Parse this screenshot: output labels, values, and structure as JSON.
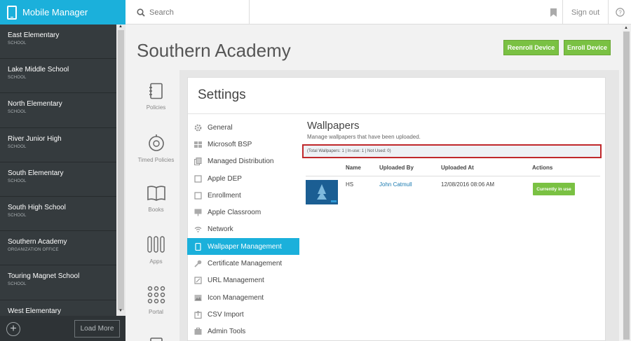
{
  "app": {
    "title": "Mobile Manager"
  },
  "search": {
    "placeholder": "Search"
  },
  "header": {
    "signout_label": "Sign out"
  },
  "sidebar": {
    "orgs": [
      {
        "name": "East Elementary",
        "type": "SCHOOL"
      },
      {
        "name": "Lake Middle School",
        "type": "SCHOOL"
      },
      {
        "name": "North Elementary",
        "type": "SCHOOL"
      },
      {
        "name": "River Junior High",
        "type": "SCHOOL"
      },
      {
        "name": "South Elementary",
        "type": "SCHOOL"
      },
      {
        "name": "South High School",
        "type": "SCHOOL"
      },
      {
        "name": "Southern Academy",
        "type": "ORGANIZATION OFFICE"
      },
      {
        "name": "Touring Magnet School",
        "type": "SCHOOL"
      },
      {
        "name": "West Elementary",
        "type": ""
      }
    ],
    "load_more": "Load More"
  },
  "page": {
    "title": "Southern Academy",
    "reenroll_label": "Reenroll Device",
    "enroll_label": "Enroll Device"
  },
  "side_icons": [
    {
      "label": "Policies",
      "icon": "notebook-icon"
    },
    {
      "label": "Timed Policies",
      "icon": "stopwatch-icon"
    },
    {
      "label": "Books",
      "icon": "book-icon"
    },
    {
      "label": "Apps",
      "icon": "apps-icon"
    },
    {
      "label": "Portal",
      "icon": "grid-dots-icon"
    }
  ],
  "settings": {
    "title": "Settings",
    "menu": [
      {
        "label": "General",
        "icon": "gear-icon"
      },
      {
        "label": "Microsoft BSP",
        "icon": "windows-icon"
      },
      {
        "label": "Managed Distribution",
        "icon": "copy-icon"
      },
      {
        "label": "Apple DEP",
        "icon": "checkbox-icon"
      },
      {
        "label": "Enrollment",
        "icon": "checkbox-icon"
      },
      {
        "label": "Apple Classroom",
        "icon": "presentation-icon"
      },
      {
        "label": "Network",
        "icon": "wifi-icon"
      },
      {
        "label": "Wallpaper Management",
        "icon": "tablet-icon",
        "active": true
      },
      {
        "label": "Certificate Management",
        "icon": "key-icon"
      },
      {
        "label": "URL Management",
        "icon": "link-icon"
      },
      {
        "label": "Icon Management",
        "icon": "image-icon"
      },
      {
        "label": "CSV Import",
        "icon": "upload-icon"
      },
      {
        "label": "Admin Tools",
        "icon": "tools-icon"
      }
    ]
  },
  "wallpapers": {
    "title": "Wallpapers",
    "subtitle": "Manage wallpapers that have been uploaded.",
    "totals": "(Total Wallpapers: 1 | In-use: 1 | Not Used: 0)",
    "columns": {
      "name": "Name",
      "uploaded_by": "Uploaded By",
      "uploaded_at": "Uploaded At",
      "actions": "Actions"
    },
    "rows": [
      {
        "name": "HS",
        "uploaded_by": "John Catmull",
        "uploaded_at": "12/08/2016 08:06 AM",
        "action": "Currently in use"
      }
    ]
  },
  "colors": {
    "brand": "#1bb0db",
    "sidebar": "#353b3e",
    "accent_green": "#7ac143",
    "highlight": "#c0282b"
  }
}
